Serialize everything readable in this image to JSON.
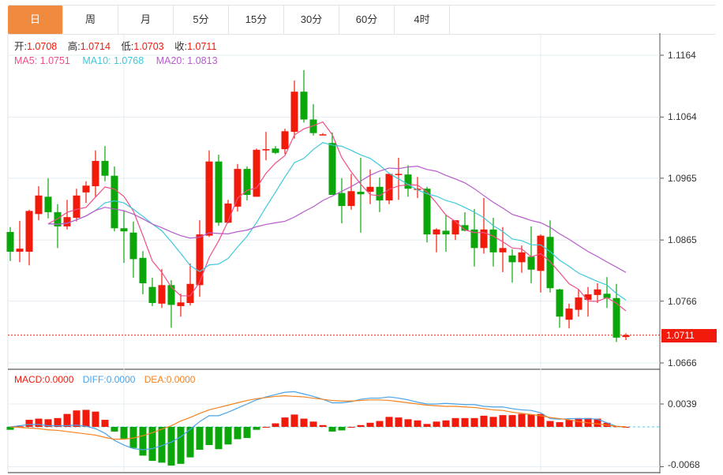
{
  "tabs": [
    {
      "label": "日",
      "active": true
    },
    {
      "label": "周"
    },
    {
      "label": "月"
    },
    {
      "label": "5分"
    },
    {
      "label": "15分"
    },
    {
      "label": "30分"
    },
    {
      "label": "60分"
    },
    {
      "label": "4时"
    }
  ],
  "ohlc_info": {
    "open_label": "开:",
    "open": "1.0708",
    "high_label": "高:",
    "high": "1.0714",
    "low_label": "低:",
    "low": "1.0703",
    "close_label": "收:",
    "close": "1.0711"
  },
  "ma_info": {
    "ma5": "MA5: 1.0751",
    "ma10": "MA10: 1.0768",
    "ma20": "MA20: 1.0813"
  },
  "macd_info": {
    "macd": "MACD:0.0000",
    "diff": "DIFF:0.0000",
    "dea": "DEA:0.0000"
  },
  "colors": {
    "up": "#f21a0a",
    "down": "#0aa60a",
    "ma5": "#ee4f8a",
    "ma10": "#3fc8dc",
    "ma20": "#b65ccc",
    "diff": "#4aa3e8",
    "dea": "#f5821f",
    "accent": "#f08a3e"
  },
  "chart_data": {
    "type": "candlestick",
    "price_axis": {
      "ticks": [
        "1.1164",
        "1.1064",
        "1.0965",
        "1.0865",
        "1.0766",
        "1.0666"
      ],
      "range": [
        1.0666,
        1.1164
      ]
    },
    "current_price": "1.0711",
    "candles": [
      [
        1.0878,
        1.0886,
        1.0831,
        1.0846
      ],
      [
        1.0846,
        1.0896,
        1.0829,
        1.0851
      ],
      [
        1.0846,
        1.0914,
        1.0824,
        1.0912
      ],
      [
        1.0907,
        1.0952,
        1.0897,
        1.0937
      ],
      [
        1.0935,
        1.0965,
        1.09,
        1.091
      ],
      [
        1.091,
        1.0923,
        1.0852,
        1.0887
      ],
      [
        1.0887,
        1.093,
        1.0882,
        1.0902
      ],
      [
        1.0901,
        1.0948,
        1.0895,
        1.0937
      ],
      [
        1.0942,
        1.096,
        1.0925,
        1.0953
      ],
      [
        1.0952,
        1.101,
        1.0935,
        1.0993
      ],
      [
        1.0993,
        1.1017,
        1.096,
        1.0969
      ],
      [
        1.0969,
        1.0984,
        1.0879,
        1.0884
      ],
      [
        1.0884,
        1.0912,
        1.0828,
        1.0879
      ],
      [
        1.0877,
        1.0895,
        1.0804,
        1.0834
      ],
      [
        1.0836,
        1.0847,
        1.0777,
        1.0795
      ],
      [
        1.0789,
        1.0804,
        1.0758,
        1.0763
      ],
      [
        1.0762,
        1.0818,
        1.0755,
        1.0792
      ],
      [
        1.0792,
        1.08,
        1.0723,
        1.076
      ],
      [
        1.0758,
        1.0778,
        1.0741,
        1.0764
      ],
      [
        1.0763,
        1.0827,
        1.0759,
        1.0794
      ],
      [
        1.0792,
        1.0897,
        1.0773,
        1.0874
      ],
      [
        1.0872,
        1.101,
        1.087,
        1.0992
      ],
      [
        1.0992,
        1.1003,
        1.0888,
        1.0893
      ],
      [
        1.0893,
        1.093,
        1.0892,
        1.0924
      ],
      [
        1.0919,
        1.0988,
        1.0911,
        1.098
      ],
      [
        1.098,
        1.0984,
        1.0929,
        1.0938
      ],
      [
        1.0935,
        1.1013,
        1.0935,
        1.1011
      ],
      [
        1.101,
        1.104,
        1.0994,
        1.1012
      ],
      [
        1.1013,
        1.1017,
        1.1004,
        1.1006
      ],
      [
        1.1012,
        1.1045,
        1.1004,
        1.1041
      ],
      [
        1.104,
        1.1123,
        1.1029,
        1.1105
      ],
      [
        1.1105,
        1.114,
        1.1055,
        1.106
      ],
      [
        1.106,
        1.1085,
        1.1034,
        1.1038
      ],
      [
        1.1036,
        1.1038,
        1.1035,
        1.1036
      ],
      [
        1.1022,
        1.1039,
        1.0938,
        1.0938
      ],
      [
        1.0941,
        1.0965,
        1.0892,
        1.092
      ],
      [
        1.092,
        1.0972,
        1.0914,
        1.0944
      ],
      [
        1.0943,
        1.0998,
        1.0877,
        1.0939
      ],
      [
        1.0943,
        1.0979,
        1.0923,
        1.0951
      ],
      [
        1.0951,
        1.0966,
        1.091,
        1.0929
      ],
      [
        1.0929,
        1.0972,
        1.0923,
        1.0972
      ],
      [
        1.0971,
        1.0998,
        1.093,
        1.0972
      ],
      [
        1.0971,
        1.0986,
        1.0935,
        1.0948
      ],
      [
        1.0946,
        1.0967,
        1.0933,
        1.0948
      ],
      [
        1.0948,
        1.0951,
        1.0861,
        1.0874
      ],
      [
        1.0874,
        1.0884,
        1.0845,
        1.0882
      ],
      [
        1.088,
        1.0906,
        1.0846,
        1.0874
      ],
      [
        1.0874,
        1.0897,
        1.0865,
        1.0897
      ],
      [
        1.0889,
        1.091,
        1.0879,
        1.088
      ],
      [
        1.0882,
        1.0915,
        1.0822,
        1.0852
      ],
      [
        1.0852,
        1.0933,
        1.0843,
        1.0882
      ],
      [
        1.0882,
        1.0901,
        1.0822,
        1.0845
      ],
      [
        1.0845,
        1.0886,
        1.0813,
        1.0852
      ],
      [
        1.084,
        1.085,
        1.0796,
        1.0829
      ],
      [
        1.0829,
        1.0856,
        1.0812,
        1.0845
      ],
      [
        1.0838,
        1.0887,
        1.0795,
        1.0817
      ],
      [
        1.0815,
        1.0874,
        1.078,
        1.0872
      ],
      [
        1.087,
        1.0897,
        1.078,
        1.0787
      ],
      [
        1.0785,
        1.0786,
        1.0723,
        1.0741
      ],
      [
        1.0736,
        1.0762,
        1.0722,
        1.0754
      ],
      [
        1.0752,
        1.0785,
        1.0741,
        1.0772
      ],
      [
        1.0768,
        1.0789,
        1.0741,
        1.0777
      ],
      [
        1.0776,
        1.0795,
        1.0763,
        1.0785
      ],
      [
        1.0778,
        1.0805,
        1.0755,
        1.0771
      ],
      [
        1.0771,
        1.0794,
        1.07,
        1.0707
      ],
      [
        1.0708,
        1.0714,
        1.0703,
        1.0711
      ]
    ],
    "macd_axis": {
      "ticks": [
        "0.0039",
        "-0.0068"
      ],
      "range": [
        -0.0068,
        0.0039
      ]
    },
    "macd_hist": [
      -0.0005,
      0.0001,
      0.0012,
      0.0014,
      0.0013,
      0.0015,
      0.0022,
      0.0028,
      0.0029,
      0.0026,
      0.0012,
      -0.0008,
      -0.002,
      -0.0036,
      -0.0049,
      -0.0058,
      -0.0061,
      -0.0066,
      -0.0063,
      -0.0052,
      -0.0039,
      -0.0031,
      -0.0038,
      -0.003,
      -0.0021,
      -0.0019,
      -0.0005,
      0.0,
      0.0006,
      0.0016,
      0.0021,
      0.0014,
      0.0009,
      0.0003,
      -0.0008,
      -0.0006,
      0.0,
      0.0003,
      0.0007,
      0.001,
      0.0017,
      0.0016,
      0.0013,
      0.0011,
      0.0005,
      0.0009,
      0.0011,
      0.0015,
      0.0015,
      0.0015,
      0.0019,
      0.0017,
      0.002,
      0.002,
      0.0022,
      0.0021,
      0.0022,
      0.001,
      0.0008,
      0.0012,
      0.0015,
      0.0015,
      0.0014,
      0.0007,
      0.0001,
      0.0
    ],
    "diff": [
      0,
      0.0002,
      0.0004,
      0.0004,
      0.0002,
      0.0002,
      0.0002,
      0.0003,
      0.0001,
      -0.0003,
      -0.0011,
      -0.0023,
      -0.0031,
      -0.0037,
      -0.0039,
      -0.0037,
      -0.0032,
      -0.0026,
      -0.0017,
      -0.0004,
      0.0009,
      0.0019,
      0.0019,
      0.0025,
      0.0032,
      0.0039,
      0.0046,
      0.0051,
      0.0055,
      0.0059,
      0.006,
      0.0056,
      0.0052,
      0.0047,
      0.0041,
      0.0041,
      0.0043,
      0.0047,
      0.0049,
      0.0049,
      0.0051,
      0.0049,
      0.0046,
      0.0042,
      0.0039,
      0.0039,
      0.004,
      0.0039,
      0.0038,
      0.0038,
      0.0035,
      0.0034,
      0.0034,
      0.0031,
      0.0029,
      0.0028,
      0.0024,
      0.0014,
      0.0013,
      0.0014,
      0.0014,
      0.0014,
      0.0013,
      0.0007,
      0.0001,
      0
    ],
    "dea": [
      0,
      -0.0001,
      -0.0002,
      -0.0003,
      -0.0005,
      -0.0006,
      -0.0008,
      -0.001,
      -0.0012,
      -0.0014,
      -0.0018,
      -0.0021,
      -0.0021,
      -0.0019,
      -0.0015,
      -0.001,
      -0.0004,
      0.0002,
      0.001,
      0.0016,
      0.0023,
      0.0029,
      0.0033,
      0.0037,
      0.0041,
      0.0045,
      0.0048,
      0.005,
      0.0052,
      0.0053,
      0.0052,
      0.0051,
      0.0049,
      0.0047,
      0.0045,
      0.0044,
      0.0044,
      0.0045,
      0.0046,
      0.0046,
      0.0045,
      0.0043,
      0.0041,
      0.0039,
      0.0037,
      0.0036,
      0.0035,
      0.0035,
      0.0034,
      0.0033,
      0.0031,
      0.0029,
      0.0028,
      0.0025,
      0.0023,
      0.0021,
      0.0019,
      0.0016,
      0.0014,
      0.0012,
      0.0009,
      0.0007,
      0.0005,
      0.0003,
      0.0001,
      0
    ]
  }
}
